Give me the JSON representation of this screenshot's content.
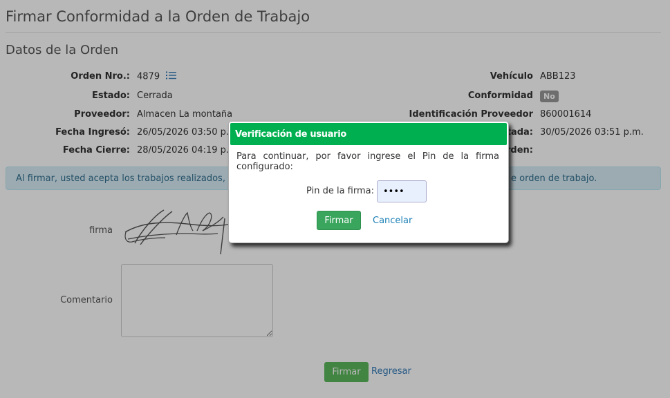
{
  "page": {
    "title": "Firmar Conformidad a la Orden de Trabajo",
    "section_title": "Datos de la Orden"
  },
  "order_left": [
    {
      "label": "Orden Nro.:",
      "value": "4879"
    },
    {
      "label": "Estado:",
      "value": "Cerrada"
    },
    {
      "label": "Proveedor:",
      "value": "Almacen La montaña"
    },
    {
      "label": "Fecha Ingresó:",
      "value": "26/05/2026 03:50 p.m."
    },
    {
      "label": "Fecha Cierre:",
      "value": "28/05/2026 04:19 p.m."
    }
  ],
  "order_right": [
    {
      "label": "Vehículo",
      "value": "ABB123"
    },
    {
      "label": "Conformidad",
      "value": "No"
    },
    {
      "label": "Identificación Proveedor",
      "value": "860001614"
    },
    {
      "label": "tada:",
      "value": "30/05/2026 03:51 p.m."
    },
    {
      "label": "rden:",
      "value": ""
    }
  ],
  "info_alert": {
    "text_left": "Al firmar, usted acepta los trabajos realizados, re",
    "text_right": "e orden de trabajo."
  },
  "form": {
    "signature_label": "firma",
    "comment_label": "Comentario",
    "comment_value": "",
    "submit_label": "Firmar",
    "back_label": "Regresar"
  },
  "dialog": {
    "title": "Verificación de usuario",
    "message": "Para continuar, por favor ingrese el Pin de la firma configurado:",
    "pin_label": "Pin de la firma:",
    "pin_value": "1234",
    "confirm_label": "Firmar",
    "cancel_label": "Cancelar"
  },
  "icons": {
    "order_list": "list-icon"
  },
  "colors": {
    "dialog_header": "#00b050",
    "success_button": "#5cb85c",
    "info_bg": "#d9edf7",
    "info_text": "#31708f",
    "link": "#337ab7",
    "badge_no": "#999999"
  }
}
